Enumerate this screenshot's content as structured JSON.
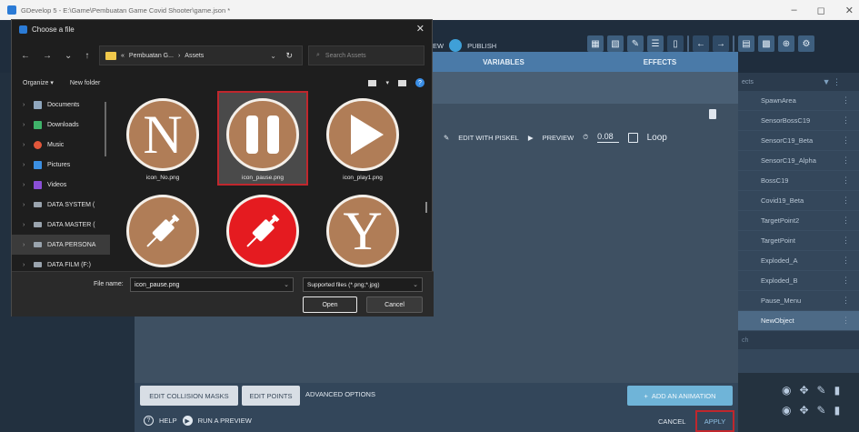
{
  "window": {
    "title": "GDevelop 5 - E:\\Game\\Pembuatan Game Covid Shooter\\game.json *"
  },
  "toolbar": {
    "preview_fragment": "EW",
    "publish": "PUBLISH"
  },
  "editor": {
    "tabs": [
      "VARIABLES",
      "EFFECTS"
    ],
    "edit_with_piskel": "EDIT WITH PISKEL",
    "preview": "PREVIEW",
    "fps": "0.08",
    "loop": "Loop",
    "edit_collision_masks": "EDIT COLLISION MASKS",
    "edit_points": "EDIT POINTS",
    "advanced_options": "ADVANCED OPTIONS",
    "add_animation": "ADD AN ANIMATION",
    "help": "HELP",
    "run_preview": "RUN A PREVIEW",
    "cancel": "CANCEL",
    "apply": "APPLY"
  },
  "objects_panel": {
    "header": "ects",
    "search": "ch",
    "items": [
      "SpawnArea",
      "SensorBossC19",
      "SensorC19_Beta",
      "SensorC19_Alpha",
      "BossC19",
      "Covid19_Beta",
      "TargetPoint2",
      "TargetPoint",
      "Exploded_A",
      "Exploded_B",
      "Pause_Menu",
      "NewObject"
    ]
  },
  "file_dialog": {
    "title": "Choose a file",
    "breadcrumb": [
      "Pembuatan G...",
      "Assets"
    ],
    "search_placeholder": "Search Assets",
    "organize": "Organize",
    "new_folder": "New folder",
    "nav_items": [
      "Documents",
      "Downloads",
      "Music",
      "Pictures",
      "Videos",
      "DATA SYSTEM (",
      "DATA MASTER (",
      "DATA PERSONA",
      "DATA FILM (F:)"
    ],
    "files": [
      {
        "name": "icon_No.png",
        "glyph": "N"
      },
      {
        "name": "icon_pause.png",
        "glyph": "pause"
      },
      {
        "name": "icon_play1.png",
        "glyph": "play"
      },
      {
        "name": "",
        "glyph": "syringe"
      },
      {
        "name": "",
        "glyph": "syringe-red"
      },
      {
        "name": "",
        "glyph": "Y"
      }
    ],
    "file_name_label": "File name:",
    "file_name_value": "icon_pause.png",
    "file_type": "Supported files (*.png;*.jpg)",
    "open": "Open",
    "cancel": "Cancel"
  },
  "colors": {
    "accent_red": "#c0272d",
    "tile_brown": "#b07d57",
    "syringe_red": "#e51b20"
  }
}
